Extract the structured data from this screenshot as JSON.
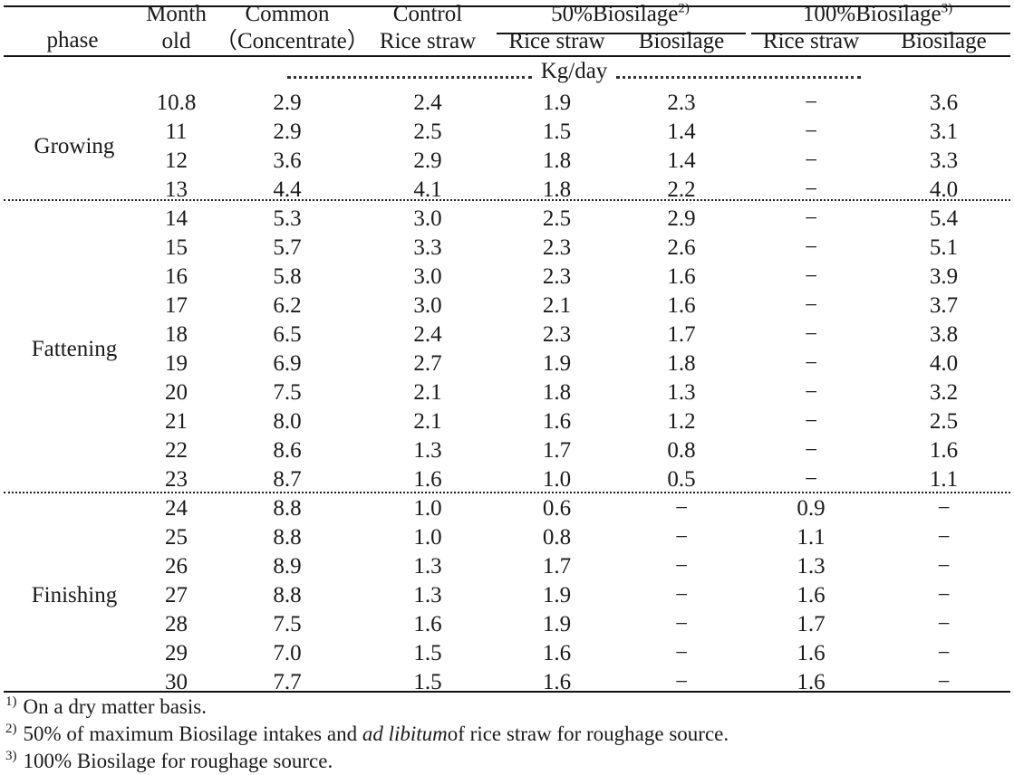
{
  "table": {
    "header": {
      "phase": "phase",
      "month_line1": "Month",
      "month_line2": "old",
      "common_line1": "Common",
      "common_line2": "（Concentrate）",
      "control_line1": "Control",
      "control_line2": "Rice straw",
      "group50_label": "50%Biosilage",
      "group50_sup": "2)",
      "group100_label": "100%Biosilage",
      "group100_sup": "3)",
      "sub_rice_straw_50": "Rice straw",
      "sub_biosilage_50": "Biosilage",
      "sub_rice_straw_100": "Rice straw",
      "sub_biosilage_100": "Biosilage"
    },
    "units_row": "Kg/day",
    "columns": [
      "phase",
      "Month old",
      "Common (Concentrate)",
      "Control Rice straw",
      "50%Biosilage Rice straw",
      "50%Biosilage Biosilage",
      "100%Biosilage Rice straw",
      "100%Biosilage Biosilage"
    ],
    "phases": [
      {
        "name": "Growing",
        "rows": [
          {
            "month": "10.8",
            "common": "2.9",
            "control_rs": "2.4",
            "bs50_rs": "1.9",
            "bs50_bs": "2.3",
            "bs100_rs": "−",
            "bs100_bs": "3.6"
          },
          {
            "month": "11",
            "common": "2.9",
            "control_rs": "2.5",
            "bs50_rs": "1.5",
            "bs50_bs": "1.4",
            "bs100_rs": "−",
            "bs100_bs": "3.1"
          },
          {
            "month": "12",
            "common": "3.6",
            "control_rs": "2.9",
            "bs50_rs": "1.8",
            "bs50_bs": "1.4",
            "bs100_rs": "−",
            "bs100_bs": "3.3"
          },
          {
            "month": "13",
            "common": "4.4",
            "control_rs": "4.1",
            "bs50_rs": "1.8",
            "bs50_bs": "2.2",
            "bs100_rs": "−",
            "bs100_bs": "4.0"
          }
        ]
      },
      {
        "name": "Fattening",
        "rows": [
          {
            "month": "14",
            "common": "5.3",
            "control_rs": "3.0",
            "bs50_rs": "2.5",
            "bs50_bs": "2.9",
            "bs100_rs": "−",
            "bs100_bs": "5.4"
          },
          {
            "month": "15",
            "common": "5.7",
            "control_rs": "3.3",
            "bs50_rs": "2.3",
            "bs50_bs": "2.6",
            "bs100_rs": "−",
            "bs100_bs": "5.1"
          },
          {
            "month": "16",
            "common": "5.8",
            "control_rs": "3.0",
            "bs50_rs": "2.3",
            "bs50_bs": "1.6",
            "bs100_rs": "−",
            "bs100_bs": "3.9"
          },
          {
            "month": "17",
            "common": "6.2",
            "control_rs": "3.0",
            "bs50_rs": "2.1",
            "bs50_bs": "1.6",
            "bs100_rs": "−",
            "bs100_bs": "3.7"
          },
          {
            "month": "18",
            "common": "6.5",
            "control_rs": "2.4",
            "bs50_rs": "2.3",
            "bs50_bs": "1.7",
            "bs100_rs": "−",
            "bs100_bs": "3.8"
          },
          {
            "month": "19",
            "common": "6.9",
            "control_rs": "2.7",
            "bs50_rs": "1.9",
            "bs50_bs": "1.8",
            "bs100_rs": "−",
            "bs100_bs": "4.0"
          },
          {
            "month": "20",
            "common": "7.5",
            "control_rs": "2.1",
            "bs50_rs": "1.8",
            "bs50_bs": "1.3",
            "bs100_rs": "−",
            "bs100_bs": "3.2"
          },
          {
            "month": "21",
            "common": "8.0",
            "control_rs": "2.1",
            "bs50_rs": "1.6",
            "bs50_bs": "1.2",
            "bs100_rs": "−",
            "bs100_bs": "2.5"
          },
          {
            "month": "22",
            "common": "8.6",
            "control_rs": "1.3",
            "bs50_rs": "1.7",
            "bs50_bs": "0.8",
            "bs100_rs": "−",
            "bs100_bs": "1.6"
          },
          {
            "month": "23",
            "common": "8.7",
            "control_rs": "1.6",
            "bs50_rs": "1.0",
            "bs50_bs": "0.5",
            "bs100_rs": "−",
            "bs100_bs": "1.1"
          }
        ]
      },
      {
        "name": "Finishing",
        "rows": [
          {
            "month": "24",
            "common": "8.8",
            "control_rs": "1.0",
            "bs50_rs": "0.6",
            "bs50_bs": "−",
            "bs100_rs": "0.9",
            "bs100_bs": "−"
          },
          {
            "month": "25",
            "common": "8.8",
            "control_rs": "1.0",
            "bs50_rs": "0.8",
            "bs50_bs": "−",
            "bs100_rs": "1.1",
            "bs100_bs": "−"
          },
          {
            "month": "26",
            "common": "8.9",
            "control_rs": "1.3",
            "bs50_rs": "1.7",
            "bs50_bs": "−",
            "bs100_rs": "1.3",
            "bs100_bs": "−"
          },
          {
            "month": "27",
            "common": "8.8",
            "control_rs": "1.3",
            "bs50_rs": "1.9",
            "bs50_bs": "−",
            "bs100_rs": "1.6",
            "bs100_bs": "−"
          },
          {
            "month": "28",
            "common": "7.5",
            "control_rs": "1.6",
            "bs50_rs": "1.9",
            "bs50_bs": "−",
            "bs100_rs": "1.7",
            "bs100_bs": "−"
          },
          {
            "month": "29",
            "common": "7.0",
            "control_rs": "1.5",
            "bs50_rs": "1.6",
            "bs50_bs": "−",
            "bs100_rs": "1.6",
            "bs100_bs": "−"
          },
          {
            "month": "30",
            "common": "7.7",
            "control_rs": "1.5",
            "bs50_rs": "1.6",
            "bs50_bs": "−",
            "bs100_rs": "1.6",
            "bs100_bs": "−"
          }
        ]
      }
    ]
  },
  "footnotes": [
    {
      "mark": "1)",
      "text": "On a dry matter basis."
    },
    {
      "mark": "2)",
      "pre": "50% of maximum Biosilage intakes and ",
      "italic": "ad libitum",
      "post": "of rice straw for roughage source."
    },
    {
      "mark": "3)",
      "text": "100% Biosilage for roughage source."
    }
  ]
}
